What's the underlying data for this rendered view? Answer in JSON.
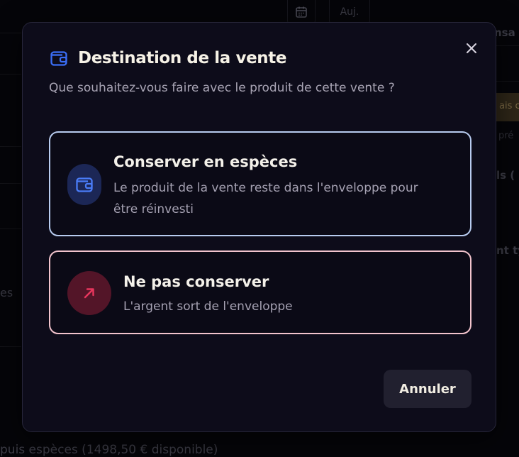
{
  "background": {
    "today_button": "Auj.",
    "right_texts": [
      "nsa",
      "ls (",
      "nt ty"
    ],
    "badge_text": "ais c",
    "small_text": "pré",
    "left_text": "es",
    "footer_text": "puis espèces (1498,50 € disponible)"
  },
  "modal": {
    "title": "Destination de la vente",
    "subtitle": "Que souhaitez-vous faire avec le produit de cette vente ?",
    "options": [
      {
        "title": "Conserver en espèces",
        "description": "Le produit de la vente reste dans l'enveloppe pour être réinvesti",
        "icon": "wallet-icon",
        "accent": "#b7cbef"
      },
      {
        "title": "Ne pas conserver",
        "description": "L'argent sort de l'enveloppe",
        "icon": "arrow-up-right-icon",
        "accent": "#f2c4cd"
      }
    ],
    "cancel_label": "Annuler",
    "close_icon": "close-icon"
  },
  "colors": {
    "brand_blue": "#3b6ef6",
    "danger_red": "#e8365d",
    "modal_bg": "#0d0c1a"
  }
}
